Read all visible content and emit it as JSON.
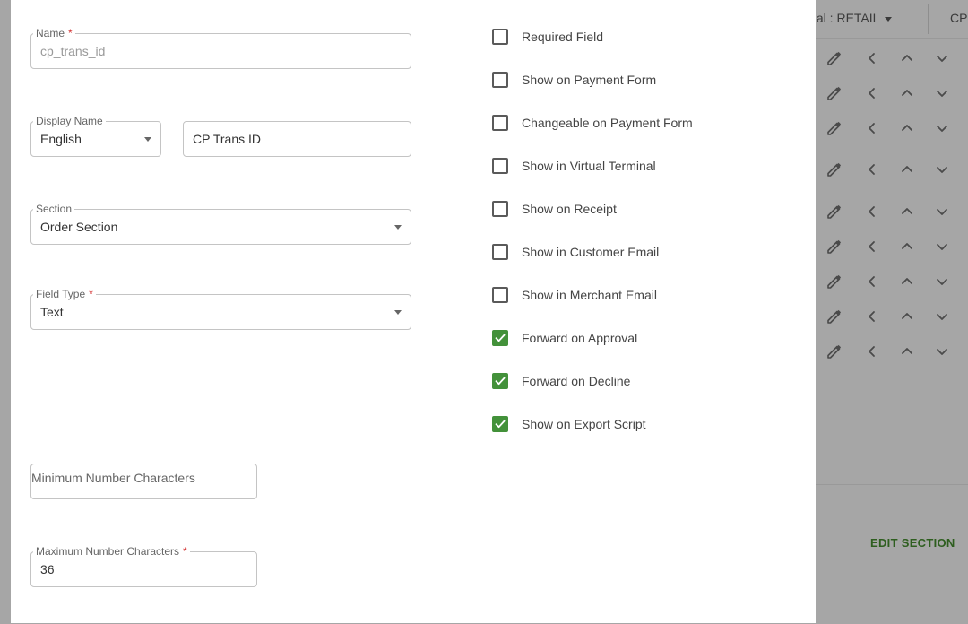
{
  "background": {
    "terminal_label": "inal : RETAIL",
    "cp_label": "CP",
    "edit_section_label": "EDIT SECTION"
  },
  "form": {
    "name": {
      "label": "Name",
      "required_mark": "*",
      "value": "cp_trans_id"
    },
    "display_name": {
      "label": "Display Name",
      "language": "English",
      "value": "CP Trans ID"
    },
    "section": {
      "label": "Section",
      "value": "Order Section"
    },
    "field_type": {
      "label": "Field Type",
      "required_mark": "*",
      "value": "Text"
    },
    "min_chars": {
      "label": "Minimum Number Characters"
    },
    "max_chars": {
      "label": "Maximum Number Characters",
      "required_mark": "*",
      "value": "36"
    }
  },
  "options": [
    {
      "label": "Required Field",
      "checked": false
    },
    {
      "label": "Show on Payment Form",
      "checked": false
    },
    {
      "label": "Changeable on Payment Form",
      "checked": false
    },
    {
      "label": "Show in Virtual Terminal",
      "checked": false
    },
    {
      "label": "Show on Receipt",
      "checked": false
    },
    {
      "label": "Show in Customer Email",
      "checked": false
    },
    {
      "label": "Show in Merchant Email",
      "checked": false
    },
    {
      "label": "Forward on Approval",
      "checked": true
    },
    {
      "label": "Forward on Decline",
      "checked": true
    },
    {
      "label": "Show on Export Script",
      "checked": true
    }
  ],
  "colors": {
    "accent_check": "#43913a",
    "required": "#d32f2f",
    "edit_section": "#2e5e1f"
  }
}
